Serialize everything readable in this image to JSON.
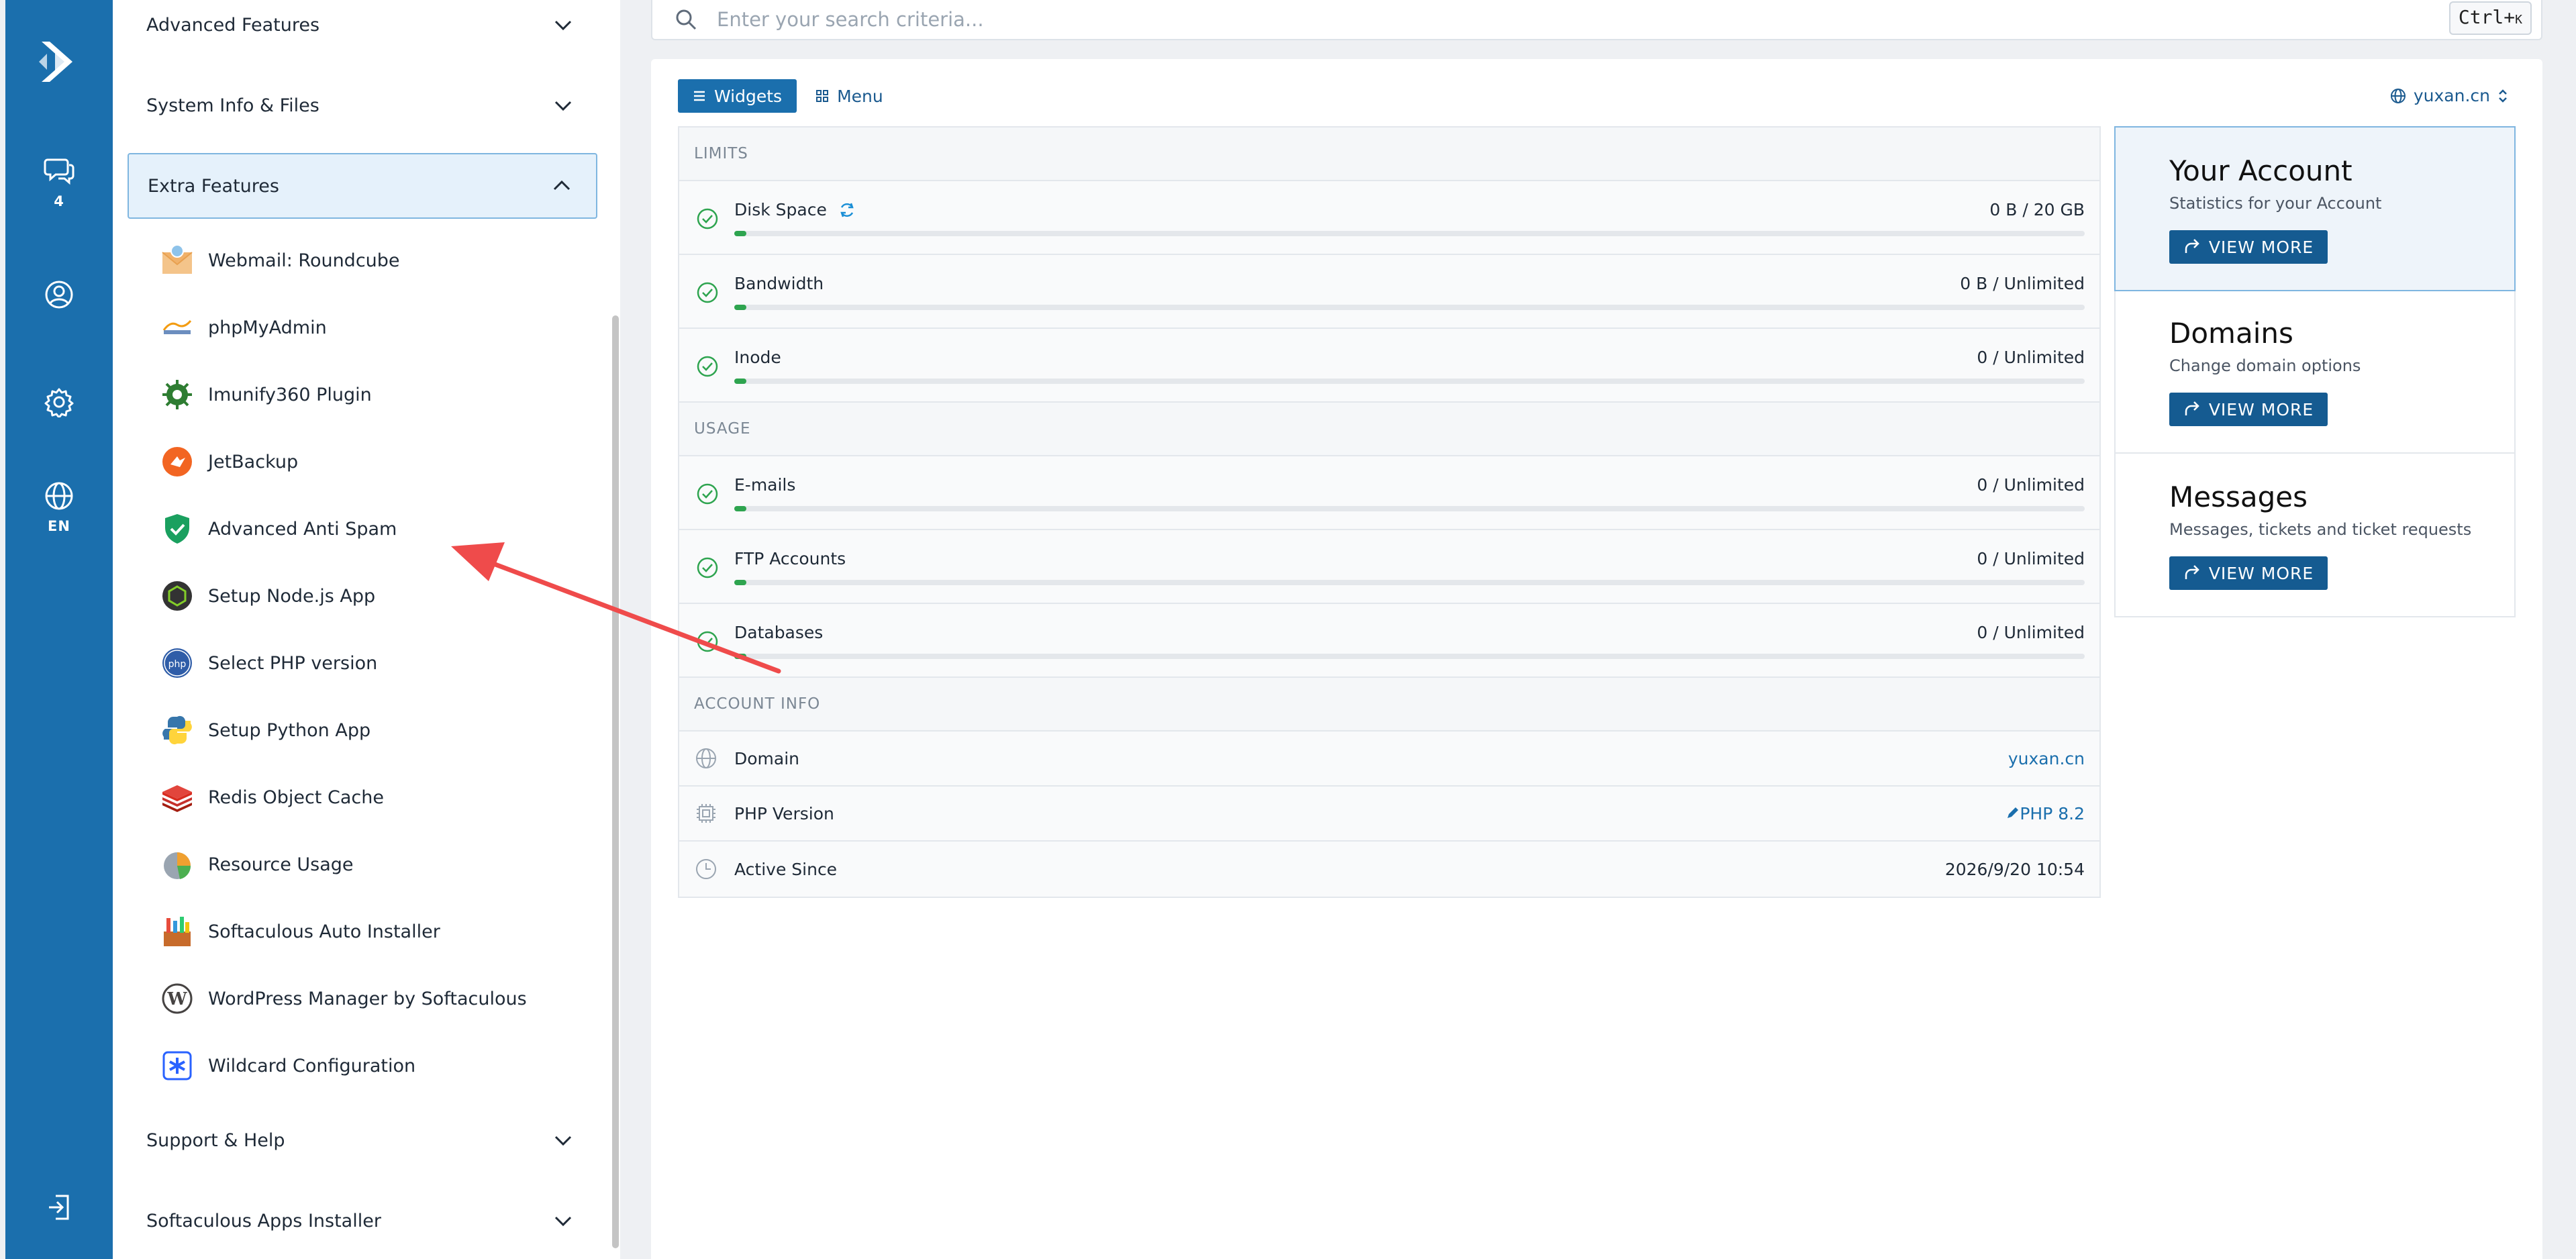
{
  "rail": {
    "items": [
      {
        "icon": "chat-icon",
        "caption": "4"
      },
      {
        "icon": "user-icon",
        "caption": ""
      },
      {
        "icon": "gear-icon",
        "caption": ""
      },
      {
        "icon": "globe-icon",
        "caption": "EN"
      },
      {
        "icon": "logout-icon",
        "caption": ""
      }
    ]
  },
  "sidebar": {
    "sections": {
      "advanced": "Advanced Features",
      "system": "System Info & Files",
      "extra": "Extra Features",
      "support": "Support & Help",
      "softaculous": "Softaculous Apps Installer"
    },
    "items": [
      {
        "label": "Webmail: Roundcube",
        "icon": "roundcube-icon"
      },
      {
        "label": "phpMyAdmin",
        "icon": "phpmyadmin-icon"
      },
      {
        "label": "Imunify360 Plugin",
        "icon": "imunify-icon"
      },
      {
        "label": "JetBackup",
        "icon": "jetbackup-icon"
      },
      {
        "label": "Advanced Anti Spam",
        "icon": "shield-icon"
      },
      {
        "label": "Setup Node.js App",
        "icon": "nodejs-icon"
      },
      {
        "label": "Select PHP version",
        "icon": "php-icon"
      },
      {
        "label": "Setup Python App",
        "icon": "python-icon"
      },
      {
        "label": "Redis Object Cache",
        "icon": "redis-icon"
      },
      {
        "label": "Resource Usage",
        "icon": "resource-usage-icon"
      },
      {
        "label": "Softaculous Auto Installer",
        "icon": "softaculous-icon"
      },
      {
        "label": "WordPress Manager by Softaculous",
        "icon": "wordpress-icon"
      },
      {
        "label": "Wildcard Configuration",
        "icon": "wildcard-icon"
      }
    ]
  },
  "search": {
    "placeholder": "Enter your search criteria...",
    "shortcut": "Ctrl+",
    "shortcut_key": "K"
  },
  "tabs": {
    "widgets": "Widgets",
    "menu": "Menu"
  },
  "domain_selector": "yuxan.cn",
  "limits": {
    "header": "LIMITS",
    "rows": [
      {
        "label": "Disk Space",
        "value": "0 B / 20 GB",
        "usage_fraction": 0.0
      },
      {
        "label": "Bandwidth",
        "value": "0 B / Unlimited",
        "usage_fraction": 0.0
      },
      {
        "label": "Inode",
        "value": "0 / Unlimited",
        "usage_fraction": 0.0
      }
    ]
  },
  "usage": {
    "header": "USAGE",
    "rows": [
      {
        "label": "E-mails",
        "value": "0 / Unlimited",
        "usage_fraction": 0.0
      },
      {
        "label": "FTP Accounts",
        "value": "0 / Unlimited",
        "usage_fraction": 0.0
      },
      {
        "label": "Databases",
        "value": "0 / Unlimited",
        "usage_fraction": 0.0
      }
    ]
  },
  "account_info": {
    "header": "ACCOUNT INFO",
    "domain_label": "Domain",
    "domain_value": "yuxan.cn",
    "php_label": "PHP Version",
    "php_value": "PHP 8.2",
    "since_label": "Active Since",
    "since_value": "2026/9/20 10:54"
  },
  "cards": [
    {
      "title": "Your Account",
      "subtitle": "Statistics for your Account",
      "button": "VIEW MORE"
    },
    {
      "title": "Domains",
      "subtitle": "Change domain options",
      "button": "VIEW MORE"
    },
    {
      "title": "Messages",
      "subtitle": "Messages, tickets and ticket requests",
      "button": "VIEW MORE"
    }
  ],
  "colors": {
    "rail": "#1b6fad",
    "accent": "#1b6fad",
    "button": "#155b91",
    "progress": "#2ea44f",
    "annotation_arrow": "#ef4b4b"
  }
}
